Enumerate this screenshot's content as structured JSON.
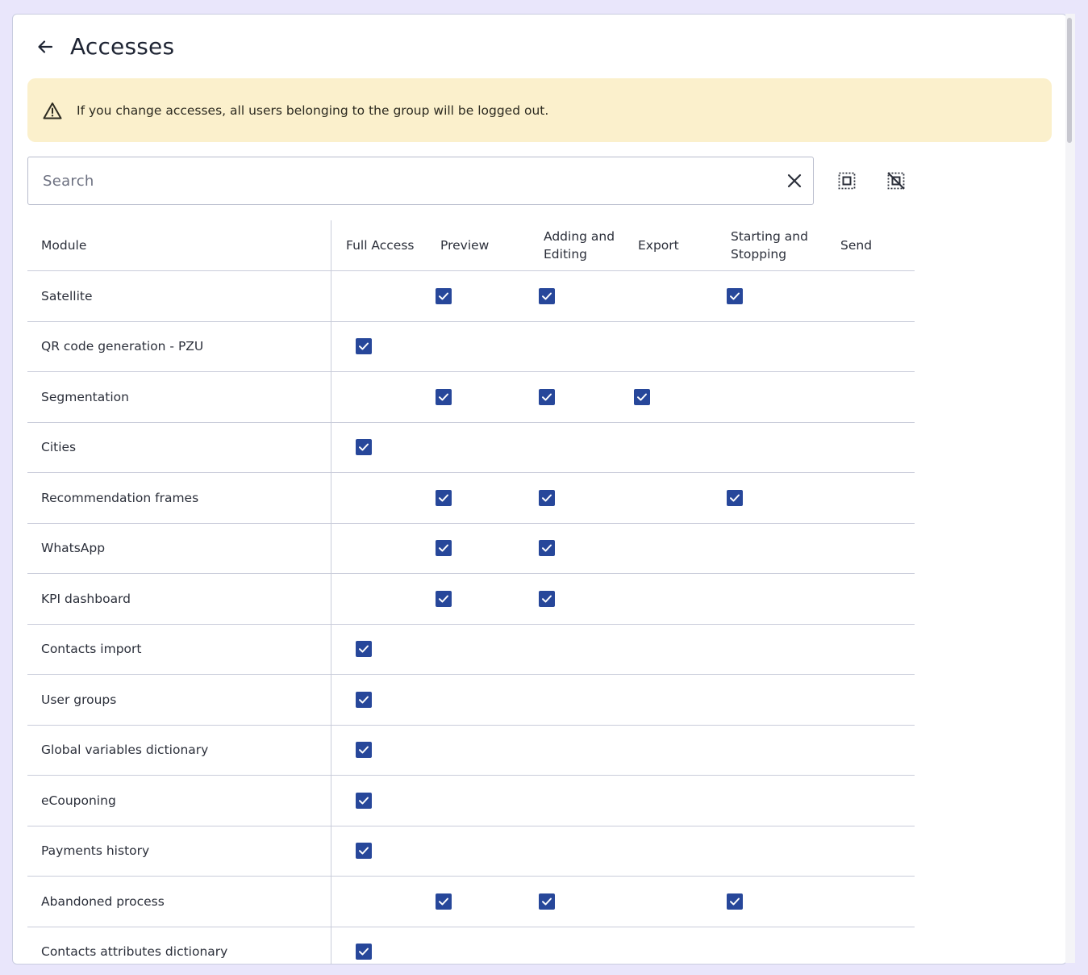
{
  "header": {
    "title": "Accesses"
  },
  "alert": {
    "message": "If you change accesses, all users belonging to the group will be logged out."
  },
  "search": {
    "placeholder": "Search",
    "value": ""
  },
  "table": {
    "columns": [
      "Module",
      "Full Access",
      "Preview",
      "Adding and Editing",
      "Export",
      "Starting and Stopping",
      "Send"
    ],
    "rows": [
      {
        "module": "Satellite",
        "checks": [
          false,
          true,
          true,
          false,
          true,
          false
        ]
      },
      {
        "module": "QR code generation - PZU",
        "checks": [
          true,
          false,
          false,
          false,
          false,
          false
        ]
      },
      {
        "module": "Segmentation",
        "checks": [
          false,
          true,
          true,
          true,
          false,
          false
        ]
      },
      {
        "module": "Cities",
        "checks": [
          true,
          false,
          false,
          false,
          false,
          false
        ]
      },
      {
        "module": "Recommendation frames",
        "checks": [
          false,
          true,
          true,
          false,
          true,
          false
        ]
      },
      {
        "module": "WhatsApp",
        "checks": [
          false,
          true,
          true,
          false,
          false,
          false
        ]
      },
      {
        "module": "KPI dashboard",
        "checks": [
          false,
          true,
          true,
          false,
          false,
          false
        ]
      },
      {
        "module": "Contacts import",
        "checks": [
          true,
          false,
          false,
          false,
          false,
          false
        ]
      },
      {
        "module": "User groups",
        "checks": [
          true,
          false,
          false,
          false,
          false,
          false
        ]
      },
      {
        "module": "Global variables dictionary",
        "checks": [
          true,
          false,
          false,
          false,
          false,
          false
        ]
      },
      {
        "module": "eCouponing",
        "checks": [
          true,
          false,
          false,
          false,
          false,
          false
        ]
      },
      {
        "module": "Payments history",
        "checks": [
          true,
          false,
          false,
          false,
          false,
          false
        ]
      },
      {
        "module": "Abandoned process",
        "checks": [
          false,
          true,
          true,
          false,
          true,
          false
        ]
      },
      {
        "module": "Contacts attributes dictionary",
        "checks": [
          true,
          false,
          false,
          false,
          false,
          false
        ]
      }
    ]
  },
  "icons": {
    "back": "arrow-left-icon",
    "warning": "warning-triangle-icon",
    "clear": "close-icon",
    "select_all": "select-all-icon",
    "deselect_all": "deselect-all-icon",
    "check": "checkbox-checked-icon"
  },
  "colors": {
    "accent": "#27479a",
    "alert_bg": "#fbf0cc",
    "page_bg": "#e9e6fb"
  }
}
